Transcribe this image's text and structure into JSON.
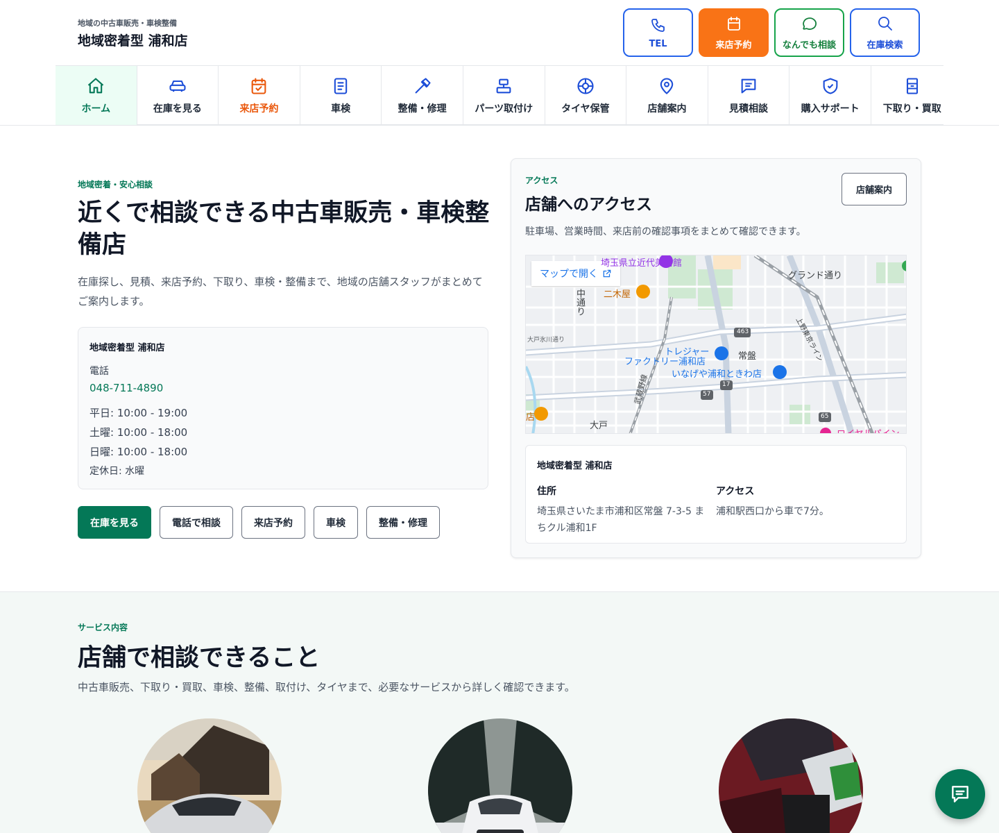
{
  "header": {
    "tagline": "地域の中古車販売・車検整備",
    "store_name": "地域密着型 浦和店",
    "buttons": [
      {
        "label": "TEL",
        "icon": "phone-icon"
      },
      {
        "label": "来店予約",
        "icon": "calendar-icon"
      },
      {
        "label": "なんでも相談",
        "icon": "chat-bubble-icon"
      },
      {
        "label": "在庫検索",
        "icon": "search-icon"
      }
    ]
  },
  "nav": {
    "items": [
      {
        "label": "ホーム",
        "icon": "home-icon"
      },
      {
        "label": "在庫を見る",
        "icon": "car-icon"
      },
      {
        "label": "来店予約",
        "icon": "calendar-check-icon"
      },
      {
        "label": "車検",
        "icon": "document-icon"
      },
      {
        "label": "整備・修理",
        "icon": "hammer-icon"
      },
      {
        "label": "パーツ取付け",
        "icon": "parts-icon"
      },
      {
        "label": "タイヤ保管",
        "icon": "tire-icon"
      },
      {
        "label": "店舗案内",
        "icon": "map-pin-icon"
      },
      {
        "label": "見積相談",
        "icon": "message-icon"
      },
      {
        "label": "購入サポート",
        "icon": "shield-check-icon"
      },
      {
        "label": "下取り・買取",
        "icon": "receipt-icon"
      }
    ]
  },
  "hero": {
    "eyebrow": "地域密着・安心相談",
    "title": "近くで相談できる中古車販売・車検整備店",
    "description": "在庫探し、見積、来店予約、下取り、車検・整備まで、地域の店舗スタッフがまとめてご案内します。",
    "info": {
      "name": "地域密着型 浦和店",
      "phone_label": "電話",
      "phone": "048-711-4890",
      "hours": [
        "平日: 10:00 - 19:00",
        "土曜: 10:00 - 18:00",
        "日曜: 10:00 - 18:00"
      ],
      "closed": "定休日: 水曜"
    },
    "ctas": [
      "在庫を見る",
      "電話で相談",
      "来店予約",
      "車検",
      "整備・修理"
    ]
  },
  "access": {
    "eyebrow": "アクセス",
    "title": "店舗へのアクセス",
    "button": "店舗案内",
    "description": "駐車場、営業時間、来店前の確認事項をまとめて確認できます。",
    "map": {
      "open_label": "マップで開く",
      "labels": {
        "museum": "埼玉県立近代美術館",
        "grand": "グランド通り",
        "nikiya": "二木屋",
        "nakado": "中通り",
        "tobe": "大戸氷川通り",
        "treasure1": "トレジャー",
        "treasure2": "ファクトリー浦和店",
        "tokiwa": "常盤",
        "inageya": "いなげや浦和ときわ店",
        "ueno": "上野東京ライン",
        "musashino": "武蔵野線",
        "r463": "463",
        "r17": "17",
        "r57": "57",
        "r65": "65",
        "ohmiya": "大戸",
        "royal": "ロイヤルパイン",
        "ten": "店"
      }
    },
    "store": {
      "name": "地域密着型 浦和店",
      "address_label": "住所",
      "address": "埼玉県さいたま市浦和区常盤 7-3-5 まちクル浦和1F",
      "access_label": "アクセス",
      "access": "浦和駅西口から車で7分。"
    }
  },
  "services": {
    "eyebrow": "サービス内容",
    "title": "店舗で相談できること",
    "description": "中古車販売、下取り・買取、車検、整備、取付け、タイヤまで、必要なサービスから詳しく確認できます。"
  },
  "colors": {
    "brand": "#047857",
    "reserve": "#f97316",
    "link": "#2563eb"
  }
}
